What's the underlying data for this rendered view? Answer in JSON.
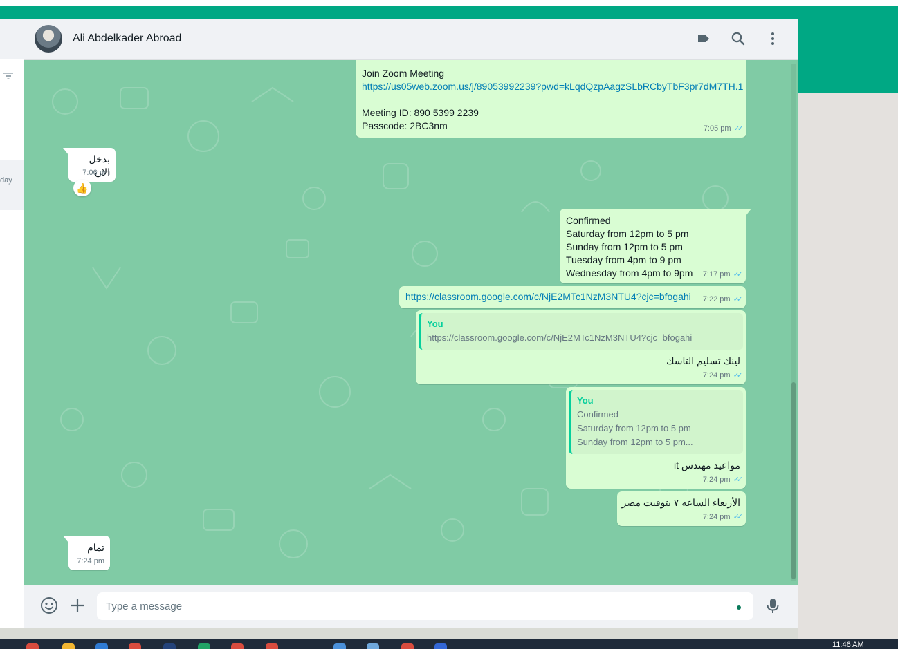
{
  "contact": {
    "name": "Ali Abdelkader Abroad"
  },
  "sidebar": {
    "day_text": "day"
  },
  "messages": [
    {
      "id": "m1",
      "dir": "out",
      "lines": [
        "Join Zoom Meeting",
        "https://us05web.zoom.us/j/89053992239?pwd=kLqdQzpAagzSLbRCbyTbF3pr7dM7TH.1",
        "",
        "Meeting ID: 890 5399 2239",
        "Passcode: 2BC3nm"
      ],
      "time": "7:05 pm"
    },
    {
      "id": "m2",
      "dir": "in",
      "text": "بدخل الان",
      "time": "7:06 pm",
      "reaction": "👍"
    },
    {
      "id": "m3",
      "dir": "out",
      "lines": [
        "Confirmed",
        "Saturday from 12pm to 5 pm",
        "Sunday from 12pm to 5 pm",
        "Tuesday from 4pm to 9 pm",
        "Wednesday from 4pm to 9pm"
      ],
      "time": "7:17 pm"
    },
    {
      "id": "m4",
      "dir": "out",
      "text": "https://classroom.google.com/c/NjE2MTc1NzM3NTU4?cjc=bfogahi",
      "time": "7:22 pm"
    },
    {
      "id": "m5",
      "dir": "out",
      "quote_author": "You",
      "quote_lines": [
        "https://classroom.google.com/c/NjE2MTc1NzM3NTU4?cjc=bfogahi"
      ],
      "text": "لينك تسليم التاسك",
      "time": "7:24 pm"
    },
    {
      "id": "m6",
      "dir": "out",
      "quote_author": "You",
      "quote_lines": [
        "Confirmed",
        "Saturday from 12pm to 5 pm",
        "Sunday from 12pm to 5 pm..."
      ],
      "text": "مواعيد مهندس it",
      "time": "7:24 pm"
    },
    {
      "id": "m7",
      "dir": "out",
      "text": "الأربعاء الساعه ٧ بتوقيت مصر",
      "time": "7:24 pm"
    },
    {
      "id": "m8",
      "dir": "in",
      "text": "تمام",
      "time": "7:24 pm"
    }
  ],
  "composer": {
    "placeholder": "Type a message"
  },
  "taskbar": {
    "clock": "11:46 AM"
  },
  "colors": {
    "accent": "#00a884",
    "chat_bg": "#80cba5",
    "outgoing": "#d9fdd3",
    "incoming": "#ffffff",
    "link": "#027eb5",
    "tick": "#53bdeb"
  },
  "icons": {
    "header": [
      "label-icon",
      "search-icon",
      "menu-icon"
    ],
    "composer": [
      "emoji-icon",
      "attach-icon",
      "mic-icon"
    ]
  }
}
